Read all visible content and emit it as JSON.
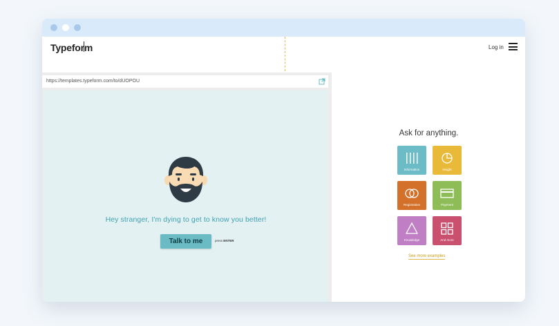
{
  "window": {
    "titlebar_color": "#d9ebfb"
  },
  "header": {
    "brand": "Typeform",
    "login": "Log in",
    "menu_icon": "hamburger-icon"
  },
  "preview": {
    "url": "https://templates.typeform.com/to/dUOPOU",
    "open_icon": "external-link-icon",
    "greeting": "Hey stranger, I'm dying to get to know you better!",
    "button_label": "Talk to me",
    "press_hint_prefix": "press",
    "press_hint_key": "ENTER",
    "background": "#e3f1f3",
    "button_color": "#6abbc4"
  },
  "panel": {
    "title": "Ask for anything.",
    "tiles": [
      {
        "label": "Information",
        "color": "#6bbcc7",
        "icon": "bars-icon"
      },
      {
        "label": "Insight",
        "color": "#e9b93a",
        "icon": "pie-chart-icon"
      },
      {
        "label": "Registration",
        "color": "#d3712a",
        "icon": "rings-icon"
      },
      {
        "label": "Payment",
        "color": "#8ebd58",
        "icon": "card-icon"
      },
      {
        "label": "Knowledge",
        "color": "#c07fc4",
        "icon": "triangle-icon"
      },
      {
        "label": "And more",
        "color": "#c9506f",
        "icon": "grid-icon"
      }
    ],
    "see_more": "See more examples"
  }
}
